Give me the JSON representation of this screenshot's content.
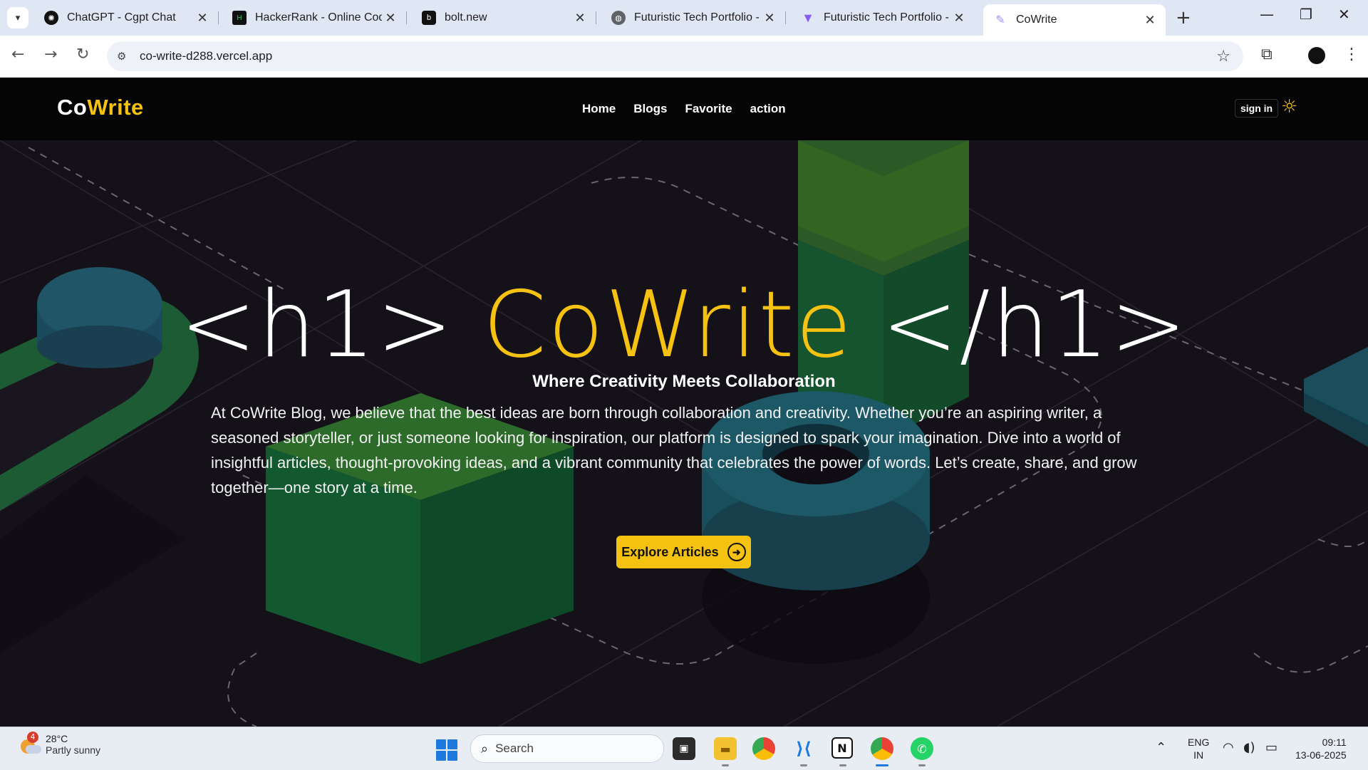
{
  "browser": {
    "tabs": [
      {
        "title": "ChatGPT - Cgpt Chat",
        "icon": "chatgpt-icon",
        "active": false
      },
      {
        "title": "HackerRank - Online Codin",
        "icon": "hackerrank-icon",
        "active": false
      },
      {
        "title": "bolt.new",
        "icon": "bolt-icon",
        "active": false
      },
      {
        "title": "Futuristic Tech Portfolio - S",
        "icon": "globe-icon",
        "active": false
      },
      {
        "title": "Futuristic Tech Portfolio - S",
        "icon": "v0-icon",
        "active": false
      },
      {
        "title": "CoWrite",
        "icon": "feather-icon",
        "active": true
      }
    ],
    "address": "co-write-d288.vercel.app"
  },
  "site": {
    "logo_part1": "Co",
    "logo_part2": "Write",
    "nav": [
      "Home",
      "Blogs",
      "Favorite",
      "action"
    ],
    "signin_label": "sign in"
  },
  "hero": {
    "tag_open": "<h1>",
    "brand": "CoWrite",
    "tag_close": "</h1>",
    "subtitle": "Where Creativity Meets Collaboration",
    "description": "At CoWrite Blog, we believe that the best ideas are born through collaboration and creativity. Whether you’re an aspiring writer, a seasoned storyteller, or just someone looking for inspiration, our platform is designed to spark your imagination. Dive into a world of insightful articles, thought-provoking ideas, and a vibrant community that celebrates the power of words. Let’s create, share, and grow together—one story at a time.",
    "cta_label": "Explore Articles"
  },
  "taskbar": {
    "weather_temp": "28°C",
    "weather_condition": "Partly sunny",
    "weather_badge": "4",
    "search_placeholder": "Search",
    "lang_line1": "ENG",
    "lang_line2": "IN",
    "time": "09:11",
    "date": "13-06-2025"
  },
  "colors": {
    "accent": "#f5c211",
    "page_bg": "#141019",
    "nav_bg": "#050505"
  }
}
